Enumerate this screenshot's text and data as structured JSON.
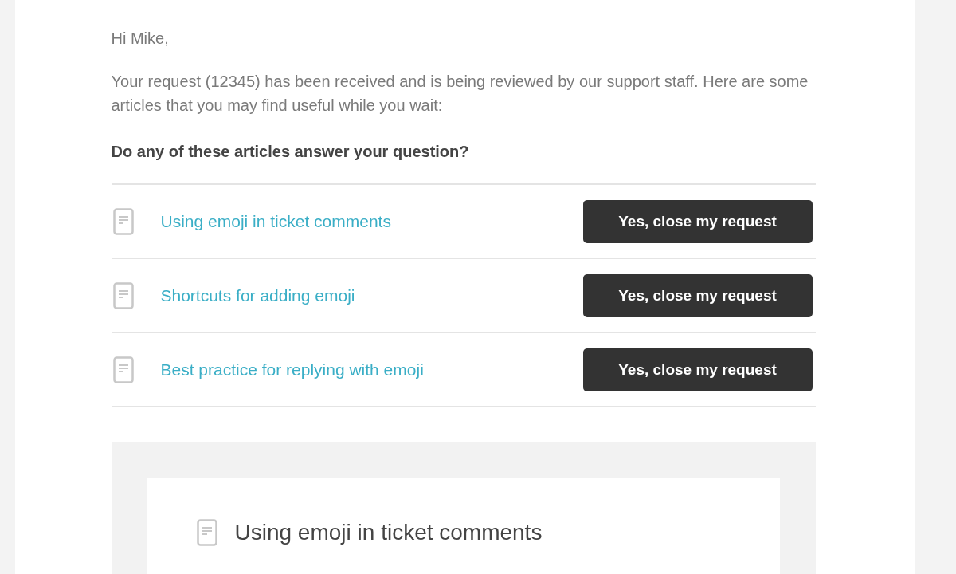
{
  "greeting": "Hi Mike,",
  "message": "Your request (12345) has been received and is being reviewed by our support staff. Here are some articles that you may find useful while you wait:",
  "question": "Do any of these articles answer your question?",
  "articles": [
    {
      "title": "Using emoji in ticket comments",
      "button": "Yes, close my request"
    },
    {
      "title": "Shortcuts for adding emoji",
      "button": "Yes, close my request"
    },
    {
      "title": "Best practice for replying with emoji",
      "button": "Yes, close my request"
    }
  ],
  "preview": {
    "title": "Using emoji in ticket comments"
  }
}
